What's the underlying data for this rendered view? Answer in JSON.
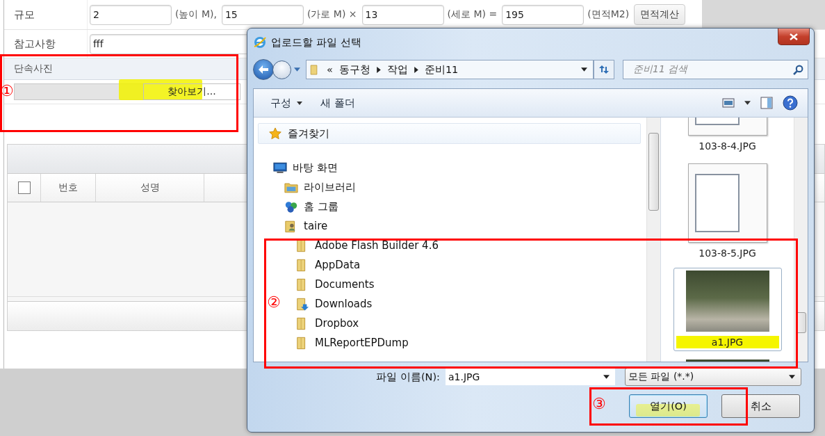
{
  "form": {
    "size_row": {
      "label": "규모",
      "fields": [
        {
          "value": "2",
          "suffix": "(높이 M),"
        },
        {
          "value": "15",
          "suffix": "(가로 M) ×"
        },
        {
          "value": "13",
          "suffix": "(세로 M) ="
        },
        {
          "value": "195",
          "suffix": "(면적M2)"
        }
      ],
      "button": "면적계산"
    },
    "note_row": {
      "label": "참고사항",
      "value": "fff"
    },
    "photo_section": {
      "title": "단속사진",
      "browse_button": {
        "label": "찾아보기...",
        "highlighted": true
      }
    },
    "table": {
      "columns": [
        {
          "kind": "checkbox",
          "checked": false
        },
        {
          "kind": "text",
          "label": "번호"
        },
        {
          "kind": "text",
          "label": "성명"
        }
      ]
    }
  },
  "dialog": {
    "title": "업로드할 파일 선택",
    "breadcrumb": {
      "overflow": "«",
      "parts": [
        "동구청",
        "작업",
        "준비11"
      ]
    },
    "search": {
      "placeholder": "준비11 검색"
    },
    "toolbar": [
      {
        "label": "구성",
        "kind": "menu"
      },
      {
        "label": "새 폴더",
        "kind": "plain"
      }
    ],
    "tree": [
      {
        "label": "즐겨찾기",
        "kind": "favorites"
      },
      {
        "label": "바탕 화면",
        "kind": "desktop",
        "children": [
          {
            "label": "라이브러리",
            "kind": "library"
          },
          {
            "label": "홈 그룹",
            "kind": "homegroup"
          },
          {
            "label": "taire",
            "kind": "user",
            "children": [
              {
                "label": "Adobe Flash Builder 4.6",
                "kind": "folder"
              },
              {
                "label": "AppData",
                "kind": "folder"
              },
              {
                "label": "Documents",
                "kind": "folder"
              },
              {
                "label": "Downloads",
                "kind": "downloads"
              },
              {
                "label": "Dropbox",
                "kind": "folder"
              },
              {
                "label": "MLReportEPDump",
                "kind": "folder"
              }
            ]
          }
        ]
      }
    ],
    "files": [
      {
        "name": "103-8-4.JPG",
        "kind": "screenshot",
        "selected": false
      },
      {
        "name": "103-8-5.JPG",
        "kind": "screenshot",
        "selected": false
      },
      {
        "name": "a1.JPG",
        "kind": "photo",
        "selected": true,
        "highlighted": true
      },
      {
        "kind": "photo",
        "selected": false
      }
    ],
    "file_name": {
      "label": "파일 이름(N):",
      "value": "a1.JPG"
    },
    "file_type": {
      "value": "모든 파일 (*.*)"
    },
    "open_button": {
      "label": "열기(O)",
      "highlighted": true
    },
    "cancel_button": {
      "label": "취소"
    }
  },
  "annotations": [
    {
      "label": "①"
    },
    {
      "label": "②"
    },
    {
      "label": "③"
    }
  ]
}
